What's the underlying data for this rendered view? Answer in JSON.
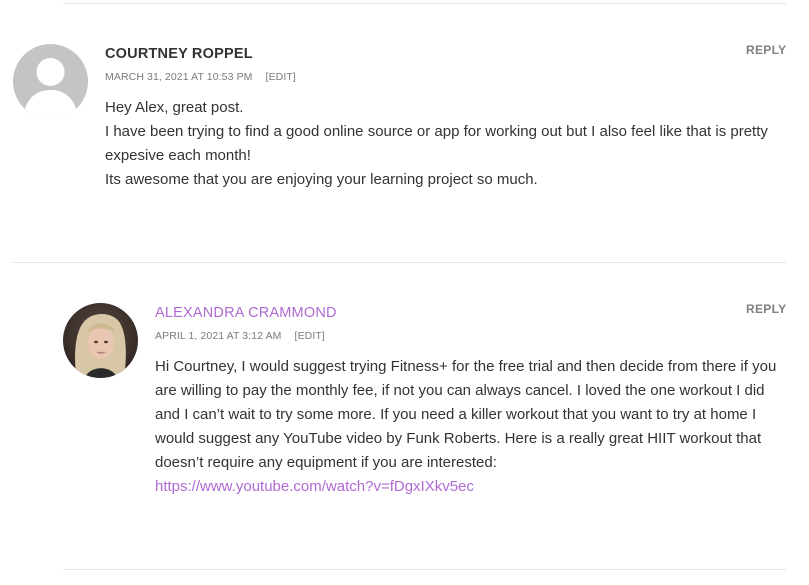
{
  "comments": [
    {
      "author": "COURTNEY ROPPEL",
      "author_color": "#333333",
      "date": "MARCH 31, 2021 AT 10:53 PM",
      "edit_label": "[EDIT]",
      "reply_label": "REPLY",
      "avatar": "default-avatar-icon",
      "lines": [
        "Hey Alex, great post.",
        "I have been trying to find a good online source or app for working out but I also feel like that is pretty expesive each month!",
        "Its awesome that you are enjoying your learning project so much."
      ]
    },
    {
      "author": "ALEXANDRA CRAMMOND",
      "author_color": "#b06ad3",
      "date": "APRIL 1, 2021 AT 3:12 AM",
      "edit_label": "[EDIT]",
      "reply_label": "REPLY",
      "avatar": "profile-photo",
      "text": "Hi Courtney, I would suggest trying Fitness+ for the free trial and then decide from there if you are willing to pay the monthly fee, if not you can always cancel. I loved the one workout I did and I can’t wait to try some more. If you need a killer workout that you want to try at home I would suggest any YouTube video by Funk Roberts. Here is a really great HIIT workout that doesn’t require any equipment if you are interested:",
      "link": "https://www.youtube.com/watch?v=fDgxIXkv5ec"
    }
  ],
  "colors": {
    "link": "#b06ad3",
    "meta": "#7a7a7a",
    "divider": "#e4e4e4"
  }
}
